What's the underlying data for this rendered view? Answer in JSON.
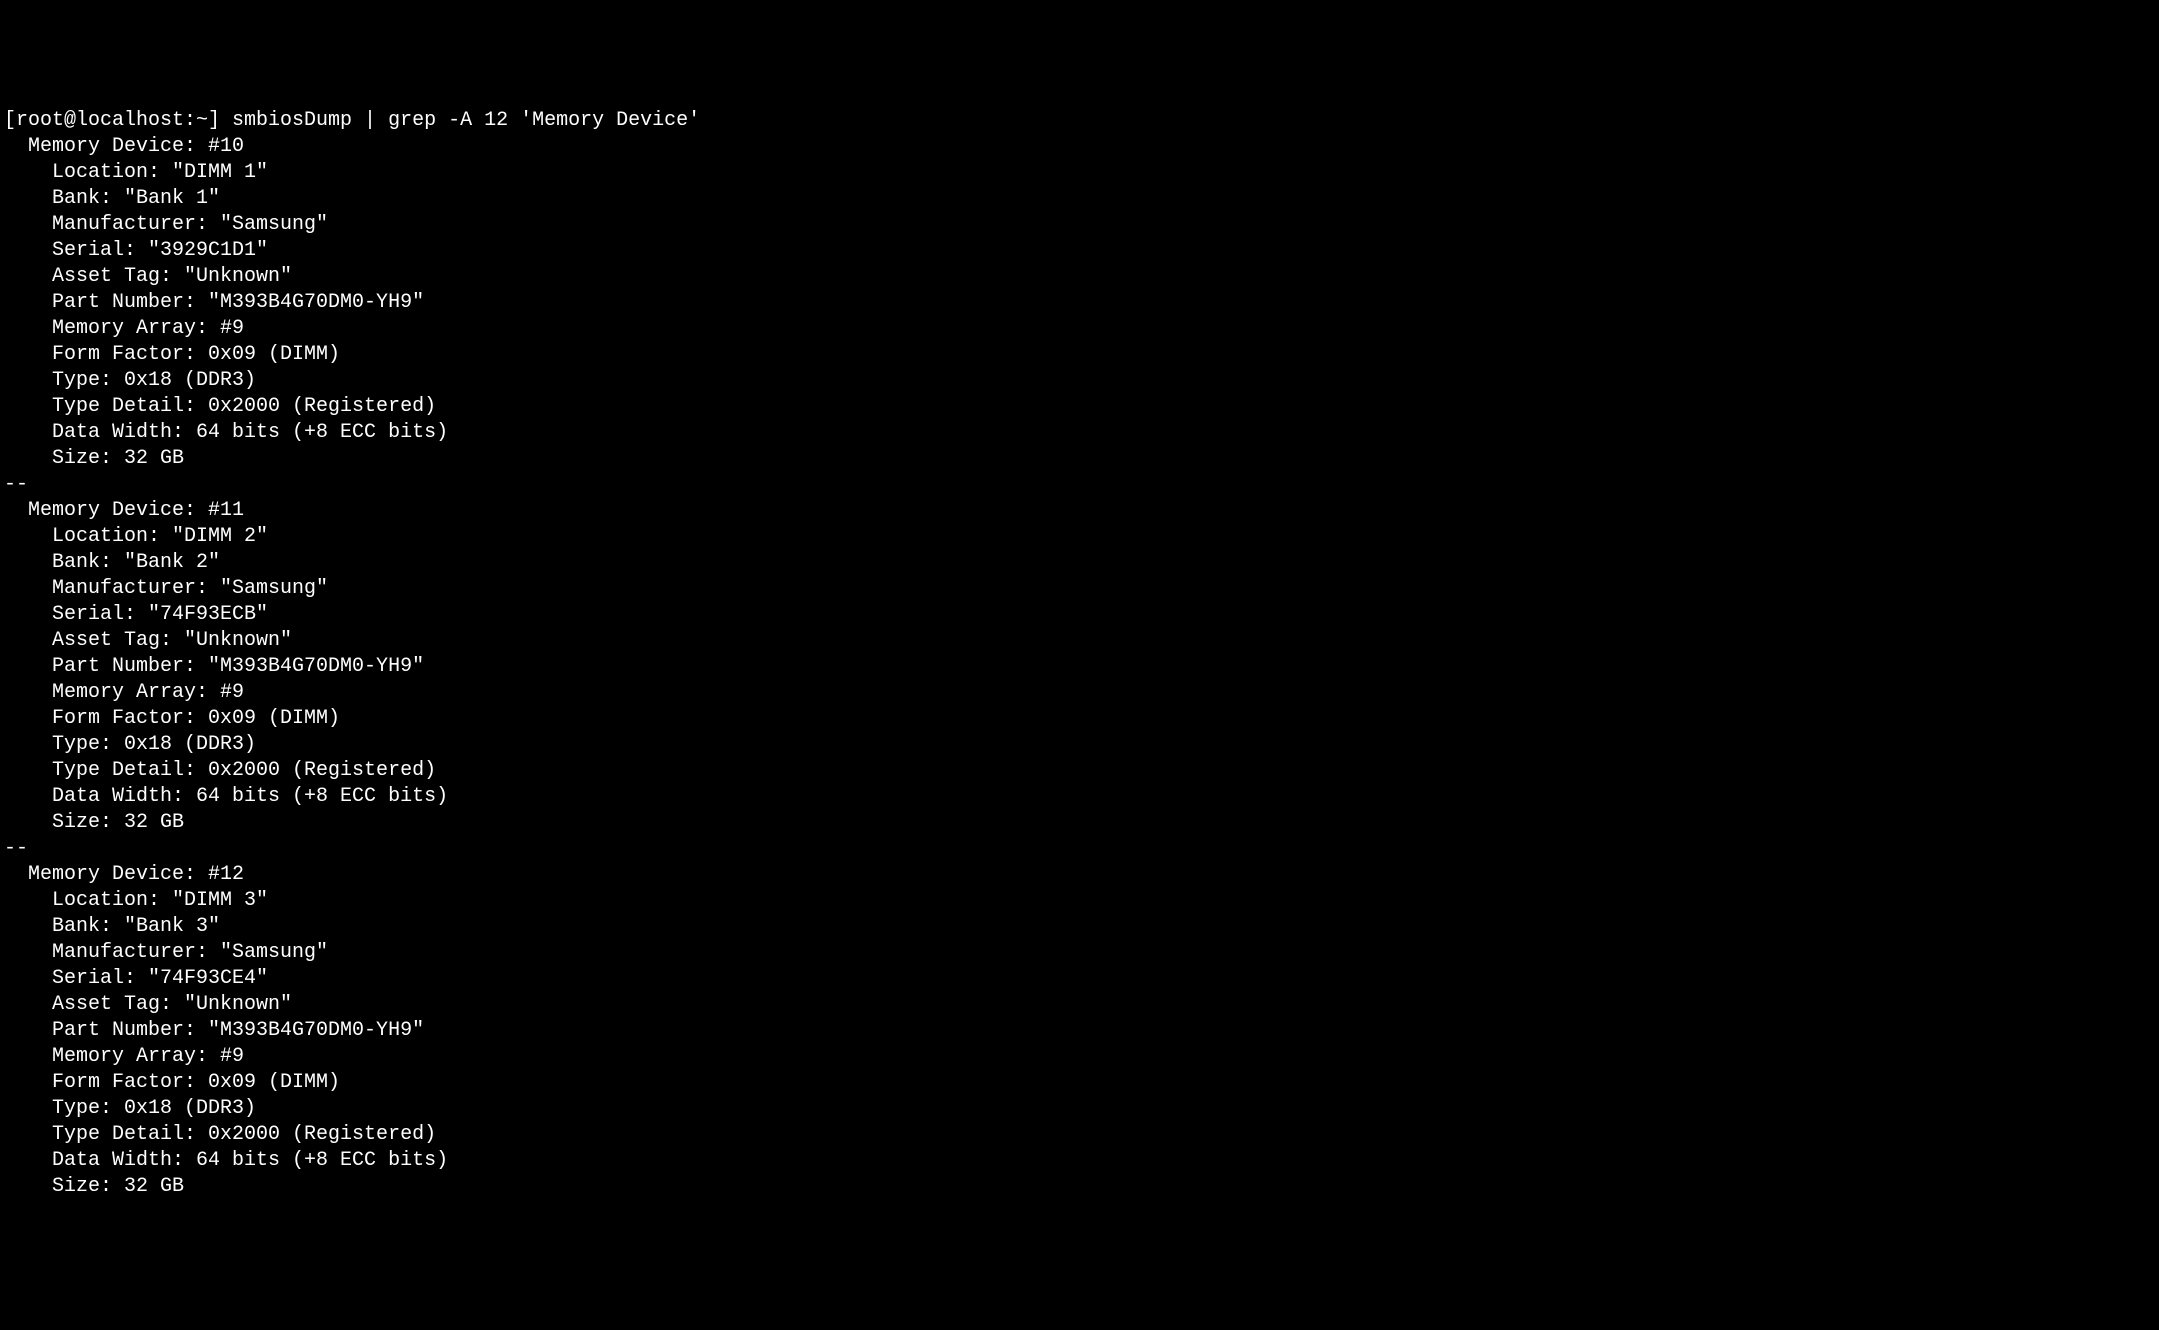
{
  "prompt": "[root@localhost:~] smbiosDump | grep -A 12 'Memory Device'",
  "devices": [
    {
      "header": "  Memory Device: #10",
      "location": "    Location: \"DIMM 1\"",
      "bank": "    Bank: \"Bank 1\"",
      "manufacturer": "    Manufacturer: \"Samsung\"",
      "serial": "    Serial: \"3929C1D1\"",
      "assetTag": "    Asset Tag: \"Unknown\"",
      "partNumber": "    Part Number: \"M393B4G70DM0-YH9\"",
      "memoryArray": "    Memory Array: #9",
      "formFactor": "    Form Factor: 0x09 (DIMM)",
      "type": "    Type: 0x18 (DDR3)",
      "typeDetail": "    Type Detail: 0x2000 (Registered)",
      "dataWidth": "    Data Width: 64 bits (+8 ECC bits)",
      "size": "    Size: 32 GB"
    },
    {
      "separator": "--",
      "header": "  Memory Device: #11",
      "location": "    Location: \"DIMM 2\"",
      "bank": "    Bank: \"Bank 2\"",
      "manufacturer": "    Manufacturer: \"Samsung\"",
      "serial": "    Serial: \"74F93ECB\"",
      "assetTag": "    Asset Tag: \"Unknown\"",
      "partNumber": "    Part Number: \"M393B4G70DM0-YH9\"",
      "memoryArray": "    Memory Array: #9",
      "formFactor": "    Form Factor: 0x09 (DIMM)",
      "type": "    Type: 0x18 (DDR3)",
      "typeDetail": "    Type Detail: 0x2000 (Registered)",
      "dataWidth": "    Data Width: 64 bits (+8 ECC bits)",
      "size": "    Size: 32 GB"
    },
    {
      "separator": "--",
      "header": "  Memory Device: #12",
      "location": "    Location: \"DIMM 3\"",
      "bank": "    Bank: \"Bank 3\"",
      "manufacturer": "    Manufacturer: \"Samsung\"",
      "serial": "    Serial: \"74F93CE4\"",
      "assetTag": "    Asset Tag: \"Unknown\"",
      "partNumber": "    Part Number: \"M393B4G70DM0-YH9\"",
      "memoryArray": "    Memory Array: #9",
      "formFactor": "    Form Factor: 0x09 (DIMM)",
      "type": "    Type: 0x18 (DDR3)",
      "typeDetail": "    Type Detail: 0x2000 (Registered)",
      "dataWidth": "    Data Width: 64 bits (+8 ECC bits)",
      "size": "    Size: 32 GB"
    }
  ]
}
